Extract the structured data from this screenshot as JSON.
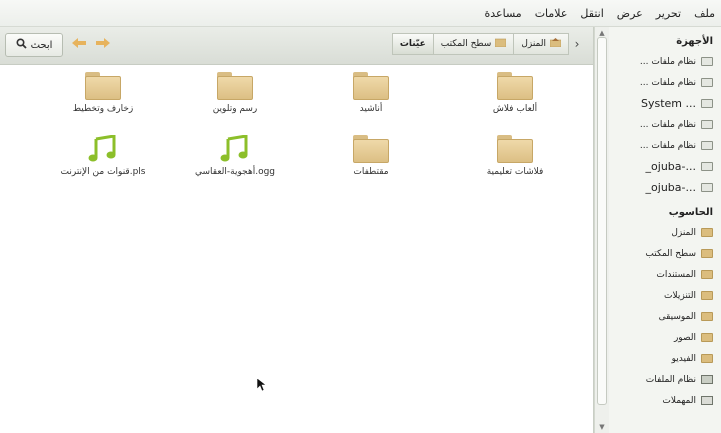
{
  "menubar": {
    "items": [
      "ملف",
      "تحرير",
      "عرض",
      "انتقل",
      "علامات",
      "مساعدة"
    ]
  },
  "toolbar": {
    "search_label": "ابحث",
    "breadcrumbs": [
      "المنزل",
      "سطح المكتب",
      "عيّنات"
    ]
  },
  "files": [
    {
      "name": "ألعاب فلاش",
      "type": "folder"
    },
    {
      "name": "أناشيد",
      "type": "folder"
    },
    {
      "name": "رسم وتلوين",
      "type": "folder"
    },
    {
      "name": "زخارف وتخطيط",
      "type": "folder"
    },
    {
      "name": "فلاشات تعليمية",
      "type": "folder"
    },
    {
      "name": "مقتطفات",
      "type": "folder"
    },
    {
      "name": "أهجوية-العقاسي.ogg",
      "type": "music"
    },
    {
      "name": "قنوات من الإنترنت.pls",
      "type": "music"
    }
  ],
  "sidebar": {
    "devices_header": "الأجهزة",
    "devices": [
      {
        "label": "نظام ملفات ..."
      },
      {
        "label": "نظام ملفات ..."
      },
      {
        "label": "System ..."
      },
      {
        "label": "نظام ملفات ..."
      },
      {
        "label": "نظام ملفات ..."
      },
      {
        "label": "_ojuba-..."
      },
      {
        "label": "_ojuba-..."
      }
    ],
    "computer_header": "الحاسوب",
    "places": [
      {
        "label": "المنزل",
        "icon": "home-folder-icon"
      },
      {
        "label": "سطح المكتب",
        "icon": "folder-icon"
      },
      {
        "label": "المستندات",
        "icon": "folder-icon"
      },
      {
        "label": "التنزيلات",
        "icon": "folder-icon"
      },
      {
        "label": "الموسيقى",
        "icon": "folder-icon"
      },
      {
        "label": "الصور",
        "icon": "folder-icon"
      },
      {
        "label": "الفيديو",
        "icon": "folder-icon"
      },
      {
        "label": "نظام الملفات",
        "icon": "filesystem-icon"
      },
      {
        "label": "المهملات",
        "icon": "trash-icon"
      }
    ]
  },
  "colors": {
    "folder": "#dcbf84",
    "music_note": "#8cbf2a"
  }
}
